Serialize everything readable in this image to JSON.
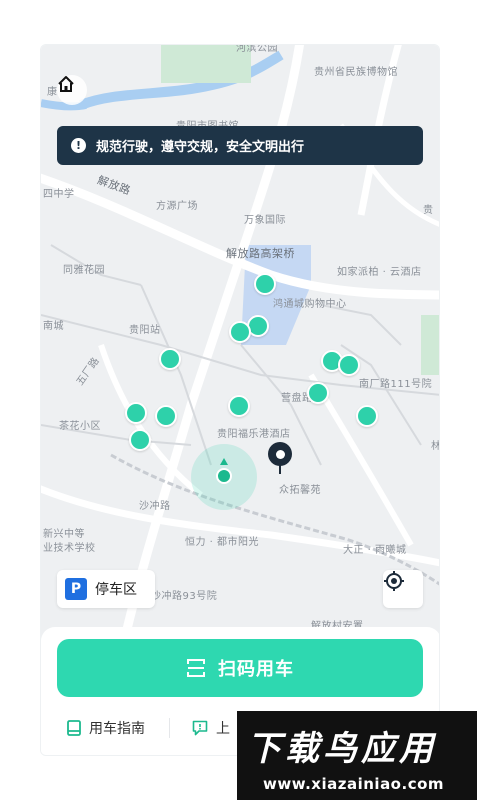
{
  "notice": {
    "text": "规范行驶，遵守交规，安全文明出行"
  },
  "map": {
    "labels": {
      "top_cut": "河滨公园",
      "museum": "贵州省民族博物馆",
      "kang": "康",
      "library": "贵阳市图书馆",
      "jiefang_rd": "解放路",
      "school4": "四中学",
      "fangyuan": "方源广场",
      "wanxiang": "万象国际",
      "gui_right": "贵",
      "viaduct": "解放路高架桥",
      "tongya": "同雅花园",
      "rujia": "如家派柏 · 云酒店",
      "hongtong": "鸿通城购物中心",
      "nancheng": "南城",
      "guiyang_station": "贵阳站",
      "wuchang": "五厂路",
      "nanchang": "南厂路111号院",
      "yingpan": "营盘路",
      "chahua": "茶花小区",
      "hotel": "贵阳福乐港酒店",
      "lin": "林",
      "zhongtuo": "众拓馨苑",
      "shachong": "沙冲路",
      "school_new": "新兴中等",
      "school_tech": "业技术学校",
      "hengli": "恒力 · 都市阳光",
      "dazheng": "大正 · 雨曦城",
      "road93": "沙冲路93号院",
      "jiefang_bottom": "解放村安置"
    }
  },
  "parking": {
    "badge": "P",
    "label": "停车区"
  },
  "scan_button": {
    "label": "扫码用车"
  },
  "links": {
    "guide": "用车指南",
    "report_partial": "上"
  },
  "watermark": {
    "title": "下载鸟应用",
    "url": "www.xiazainiao.com"
  },
  "colors": {
    "accent": "#2ed8b0",
    "notice_bg": "#1e3447",
    "parking_blue": "#1f6fe0"
  },
  "icons": {
    "home": "home-icon",
    "notice": "exclamation-icon",
    "locate": "crosshair-icon",
    "scan": "scan-icon",
    "guide": "book-icon",
    "report": "feedback-icon"
  }
}
